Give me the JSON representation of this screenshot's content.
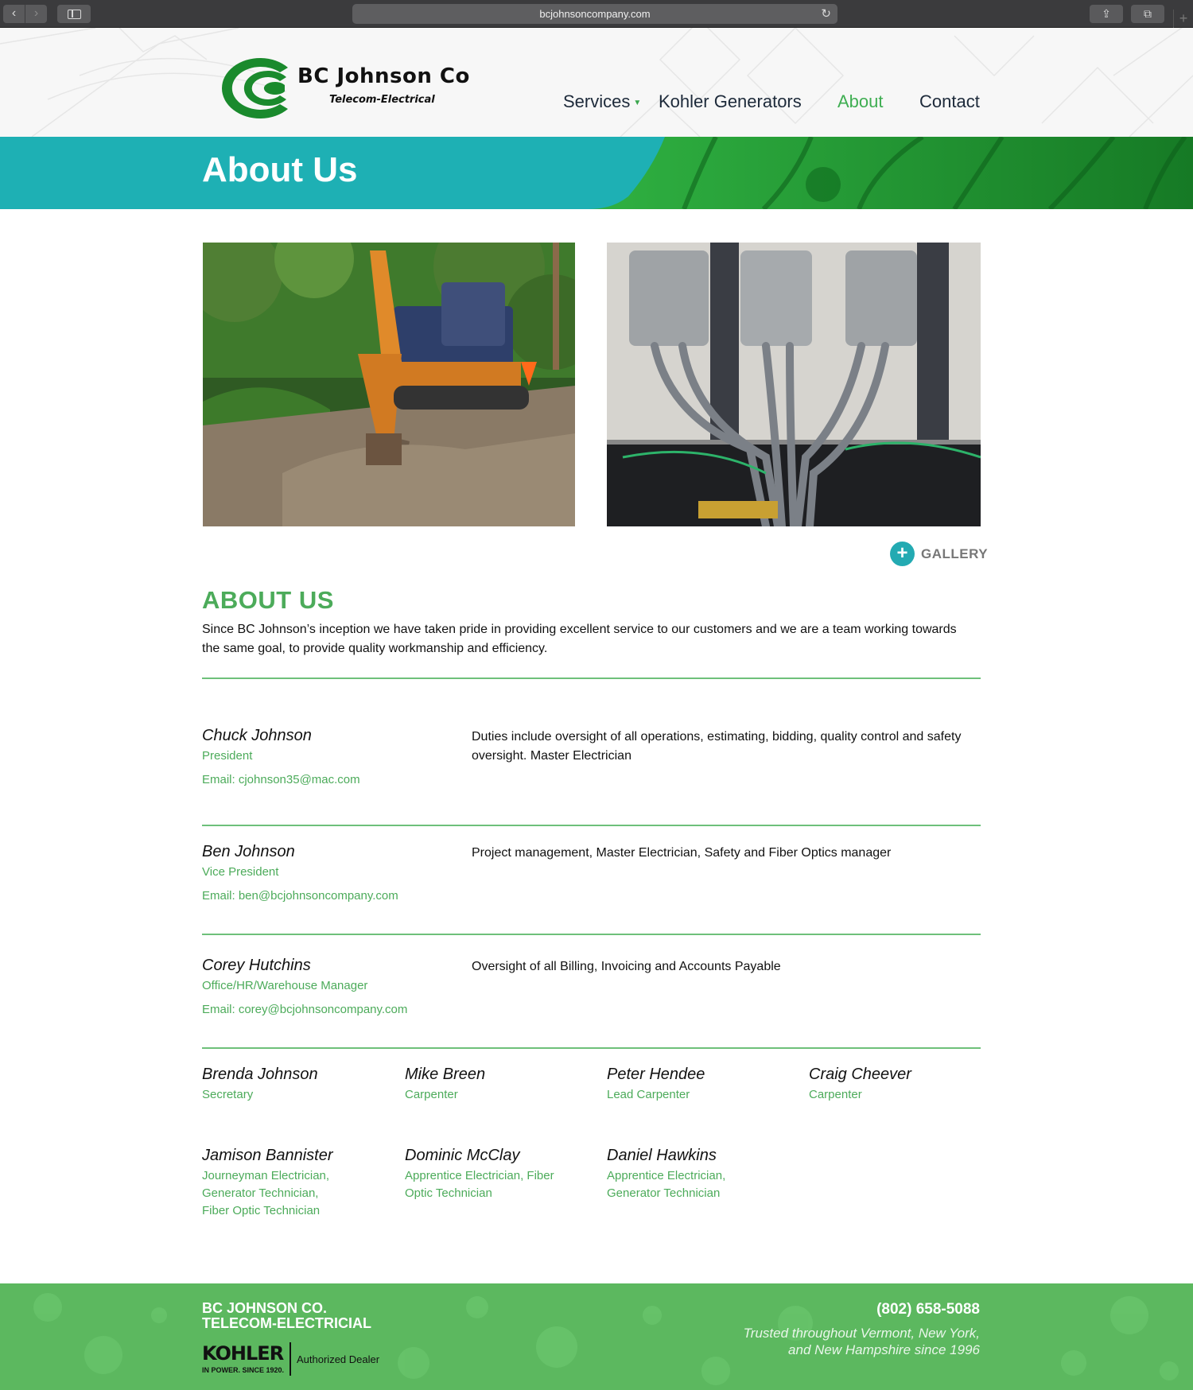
{
  "browser": {
    "url": "bcjohnsoncompany.com"
  },
  "logo": {
    "name": "BC Johnson Co",
    "tagline": "Telecom-Electrical"
  },
  "nav": {
    "services": "Services",
    "kohler": "Kohler Generators",
    "about": "About",
    "contact": "Contact"
  },
  "banner": {
    "title": "About Us"
  },
  "gallery": {
    "label": "GALLERY"
  },
  "about": {
    "heading": "ABOUT US",
    "intro": "Since BC Johnson’s inception we have taken pride in providing excellent  service to our customers and we are a team working towards the same goal, to provide quality workmanship and efficiency."
  },
  "leaders": [
    {
      "name": "Chuck Johnson",
      "role": "President",
      "email": "Email: cjohnson35@mac.com",
      "duties": "Duties include oversight of all operations, estimating, bidding, quality control and safety oversight. Master Electrician"
    },
    {
      "name": "Ben Johnson",
      "role": "Vice President",
      "email": "Email: ben@bcjohnsoncompany.com",
      "duties": "Project management, Master Electrician, Safety and Fiber Optics manager"
    },
    {
      "name": "Corey Hutchins",
      "role": "Office/HR/Warehouse Manager",
      "email": "Email: corey@bcjohnsoncompany.com",
      "duties": "Oversight of all Billing, Invoicing and Accounts Payable"
    }
  ],
  "staff": [
    {
      "name": "Brenda Johnson",
      "role": "Secretary"
    },
    {
      "name": "Mike Breen",
      "role": "Carpenter"
    },
    {
      "name": "Peter Hendee",
      "role": "Lead Carpenter"
    },
    {
      "name": "Craig Cheever",
      "role": "Carpenter"
    },
    {
      "name": "Jamison Bannister",
      "role": "Journeyman Electrician, Generator Technician,  Fiber Optic Technician"
    },
    {
      "name": "Dominic McClay",
      "role": "Apprentice Electrician, Fiber Optic Technician"
    },
    {
      "name": "Daniel Hawkins",
      "role": "Apprentice Electrician, Generator Technician"
    }
  ],
  "footer": {
    "company_line1": "BC JOHNSON CO.",
    "company_line2": "TELECOM-ELECTRICIAL",
    "kohler_logo": "KOHLER",
    "kohler_tagline": "IN POWER. SINCE 1920.",
    "dealer": "Authorized Dealer",
    "phone": "(802) 658-5088",
    "trust_line1": "Trusted throughout Vermont, New York,",
    "trust_line2": "and New Hampshire since 1996"
  },
  "colors": {
    "brand_green": "#4cab5a",
    "teal": "#23aab2",
    "footer_green": "#5cb85f"
  }
}
